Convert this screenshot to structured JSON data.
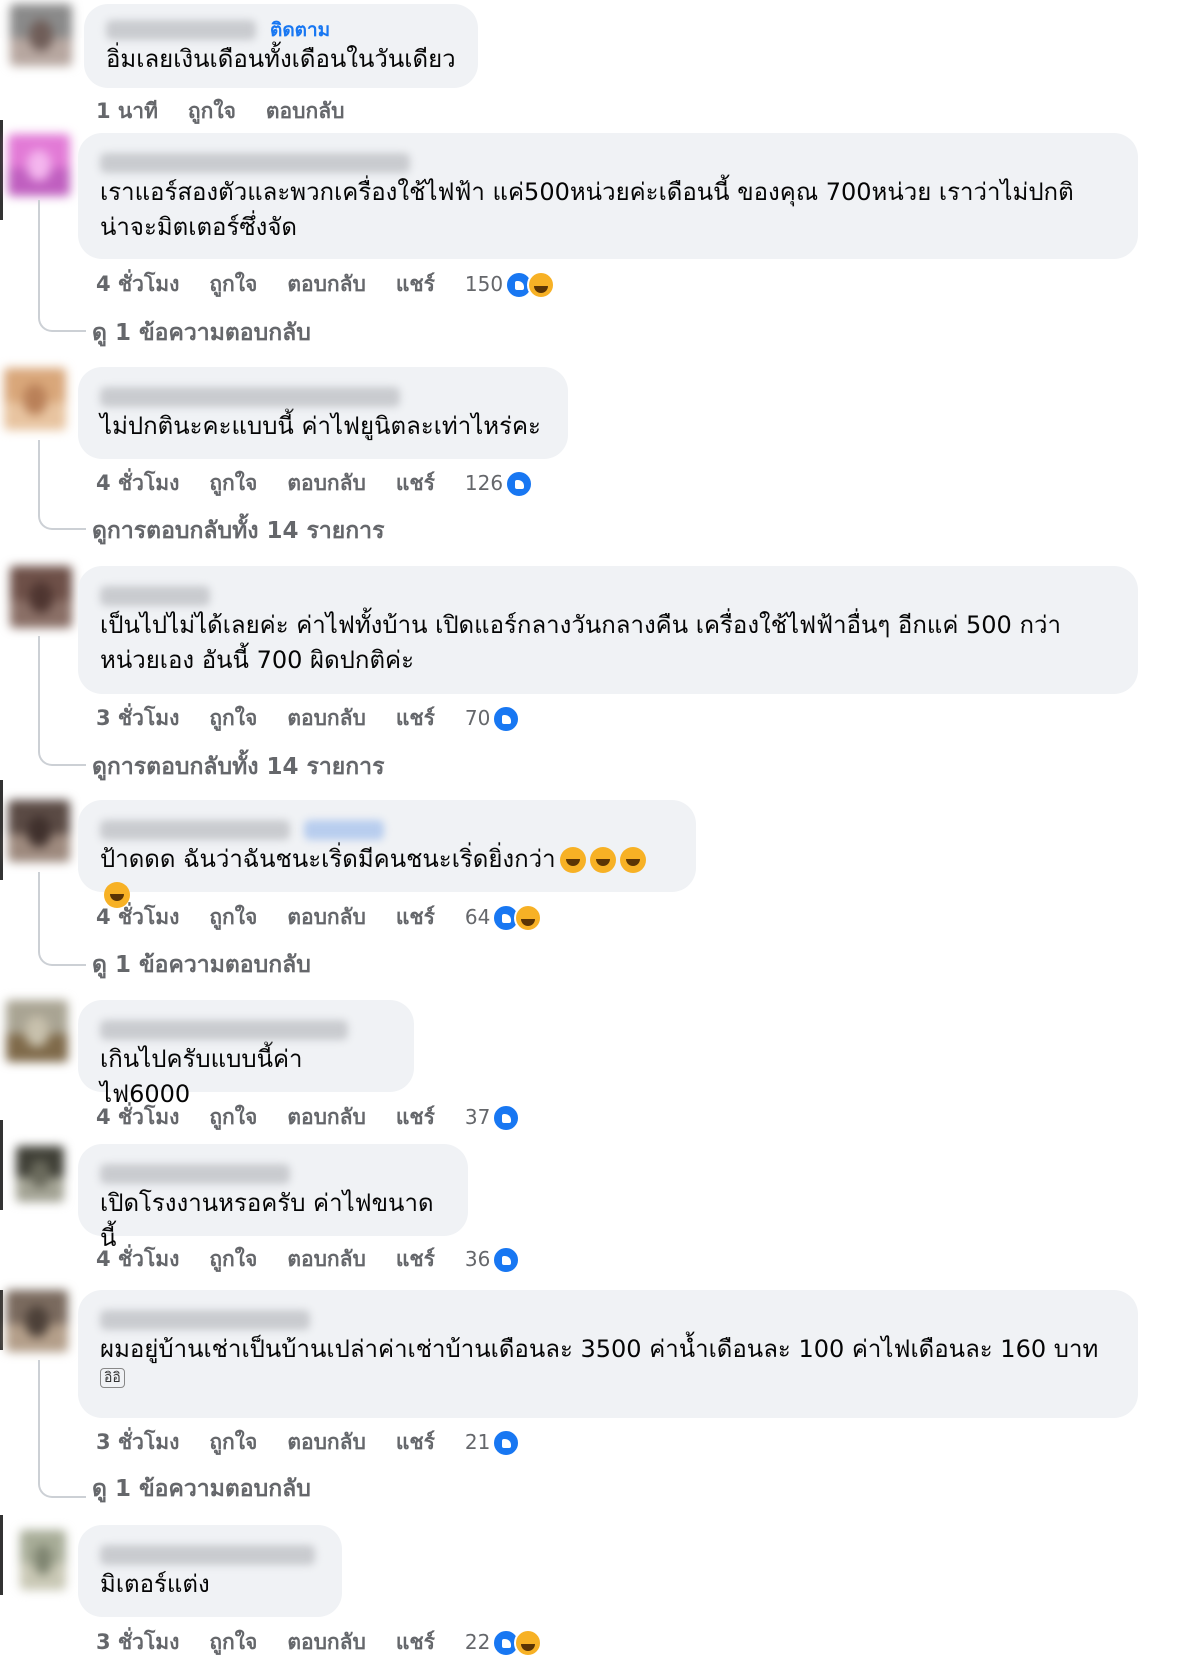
{
  "labels": {
    "like": "ถูกใจ",
    "reply": "ตอบกลับ",
    "share": "แชร์",
    "follow": "ติดตาม"
  },
  "comments": [
    {
      "text": "อิ่มเลยเงินเดือนทั้งเดือนในวันเดียว",
      "time": "1 นาที",
      "follow": "ติดตาม"
    },
    {
      "text": "เราแอร์สองตัวและพวกเครื่องใช้ไฟฟ้า แค่500หน่วยค่ะเดือนนี้ ของคุณ 700หน่วย เราว่าไม่ปกติ\nน่าจะมิตเตอร์ซึ่งจัด",
      "time": "4 ชั่วโมง",
      "count": "150",
      "view_replies": "ดู 1 ข้อความตอบกลับ"
    },
    {
      "text": "ไม่ปกตินะคะแบบนี้ ค่าไฟยูนิตละเท่าไหร่คะ",
      "time": "4 ชั่วโมง",
      "count": "126",
      "view_replies": "ดูการตอบกลับทั้ง 14 รายการ"
    },
    {
      "text": "เป็นไปไม่ได้เลยค่ะ ค่าไฟทั้งบ้าน เปิดแอร์กลางวันกลางคืน เครื่องใช้ไฟฟ้าอื่นๆ อีกแค่ 500 กว่า\nหน่วยเอง อันนี้ 700 ผิดปกติค่ะ",
      "time": "3 ชั่วโมง",
      "count": "70",
      "view_replies": "ดูการตอบกลับทั้ง 14 รายการ"
    },
    {
      "text": "ป้าดดด ฉันว่าฉันชนะเริ่ดมีคนชนะเริ่ดยิ่งกว่า",
      "time": "4 ชั่วโมง",
      "count": "64",
      "view_replies": "ดู 1 ข้อความตอบกลับ"
    },
    {
      "text": "เกินไปครับแบบนี้ค่าไฟ6000",
      "time": "4 ชั่วโมง",
      "count": "37"
    },
    {
      "text": "เปิดโรงงานหรอครับ ค่าไฟขนาดนี้",
      "time": "4 ชั่วโมง",
      "count": "36"
    },
    {
      "text": "ผมอยู่บ้านเช่าเป็นบ้านเปล่าค่าเช่าบ้านเดือนละ 3500 ค่าน้ำเดือนละ 100 ค่าไฟเดือนละ 160 บาท",
      "sub_emoji": "อิอิ",
      "time": "3 ชั่วโมง",
      "count": "21",
      "view_replies": "ดู 1 ข้อความตอบกลับ"
    },
    {
      "text": "มิเตอร์แต่ง",
      "time": "3 ชั่วโมง",
      "count": "22"
    }
  ]
}
